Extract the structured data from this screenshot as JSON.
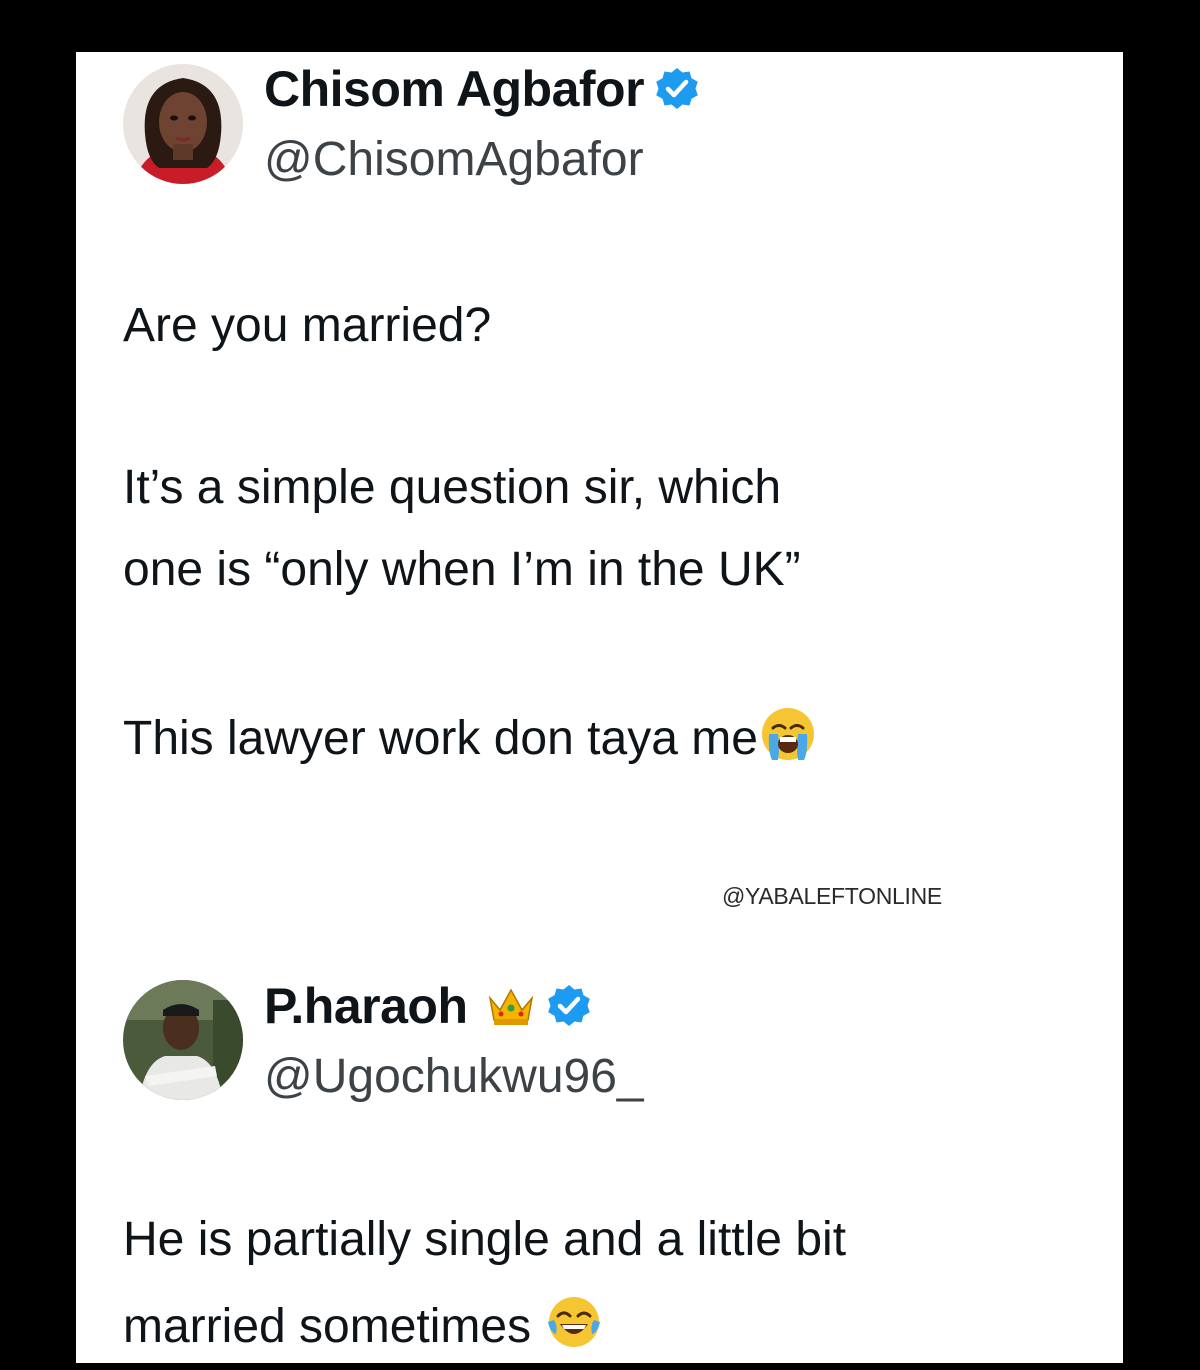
{
  "tweet1": {
    "name": "Chisom Agbafor",
    "handle": "@ChisomAgbafor",
    "verified_icon": "verified-badge-icon",
    "lines": [
      "Are you married?",
      "It’s a simple question sir, which",
      "one is “only when I’m in the UK”",
      "This lawyer work don taya me"
    ],
    "emoji": "loudly-crying-face-emoji"
  },
  "watermark": "@YABALEFTONLINE",
  "tweet2": {
    "name": "P.haraoh",
    "handle": "@Ugochukwu96_",
    "crown_icon": "crown-emoji",
    "verified_icon": "verified-badge-icon",
    "lines": [
      "He is partially single and a little bit",
      "married sometimes"
    ],
    "emoji": "tears-of-joy-emoji"
  },
  "colors": {
    "background": "#000000",
    "card": "#ffffff",
    "text": "#0f1419",
    "handle": "#3d4246",
    "verified": "#1d9bf0"
  }
}
